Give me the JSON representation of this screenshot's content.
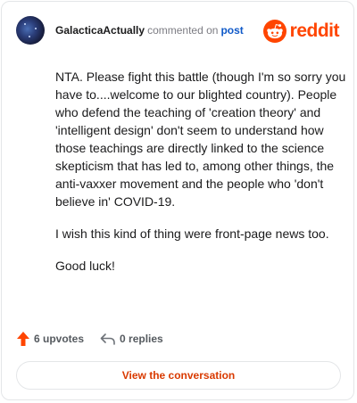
{
  "header": {
    "username": "GalacticaActually",
    "action_text": "commented on",
    "post_link": "post",
    "brand_wordmark": "reddit"
  },
  "comment": {
    "paragraphs": [
      "NTA. Please fight this battle (though I'm so sorry you have to....welcome to our blighted country). People who defend the teaching of 'creation theory' and 'intelligent design' don't seem to understand how those teachings are directly linked to the science skepticism that has led to, among other things, the anti-vaxxer movement and the people who 'don't believe in' COVID-19.",
      "I wish this kind of thing were front-page news too.",
      "Good luck!"
    ]
  },
  "footer": {
    "upvotes": "6 upvotes",
    "replies": "0 replies"
  },
  "cta": {
    "label": "View the conversation"
  },
  "icons": {
    "avatar": "galaxy-avatar",
    "brand": "reddit-snoo-icon",
    "upvote": "upvote-arrow-icon",
    "reply": "reply-arrow-icon"
  },
  "colors": {
    "brand": "#ff4500",
    "link": "#0f59c8",
    "cta_text": "#d93a00",
    "upvote_arrow": "#ff4500",
    "muted_text": "#7c7c83"
  }
}
